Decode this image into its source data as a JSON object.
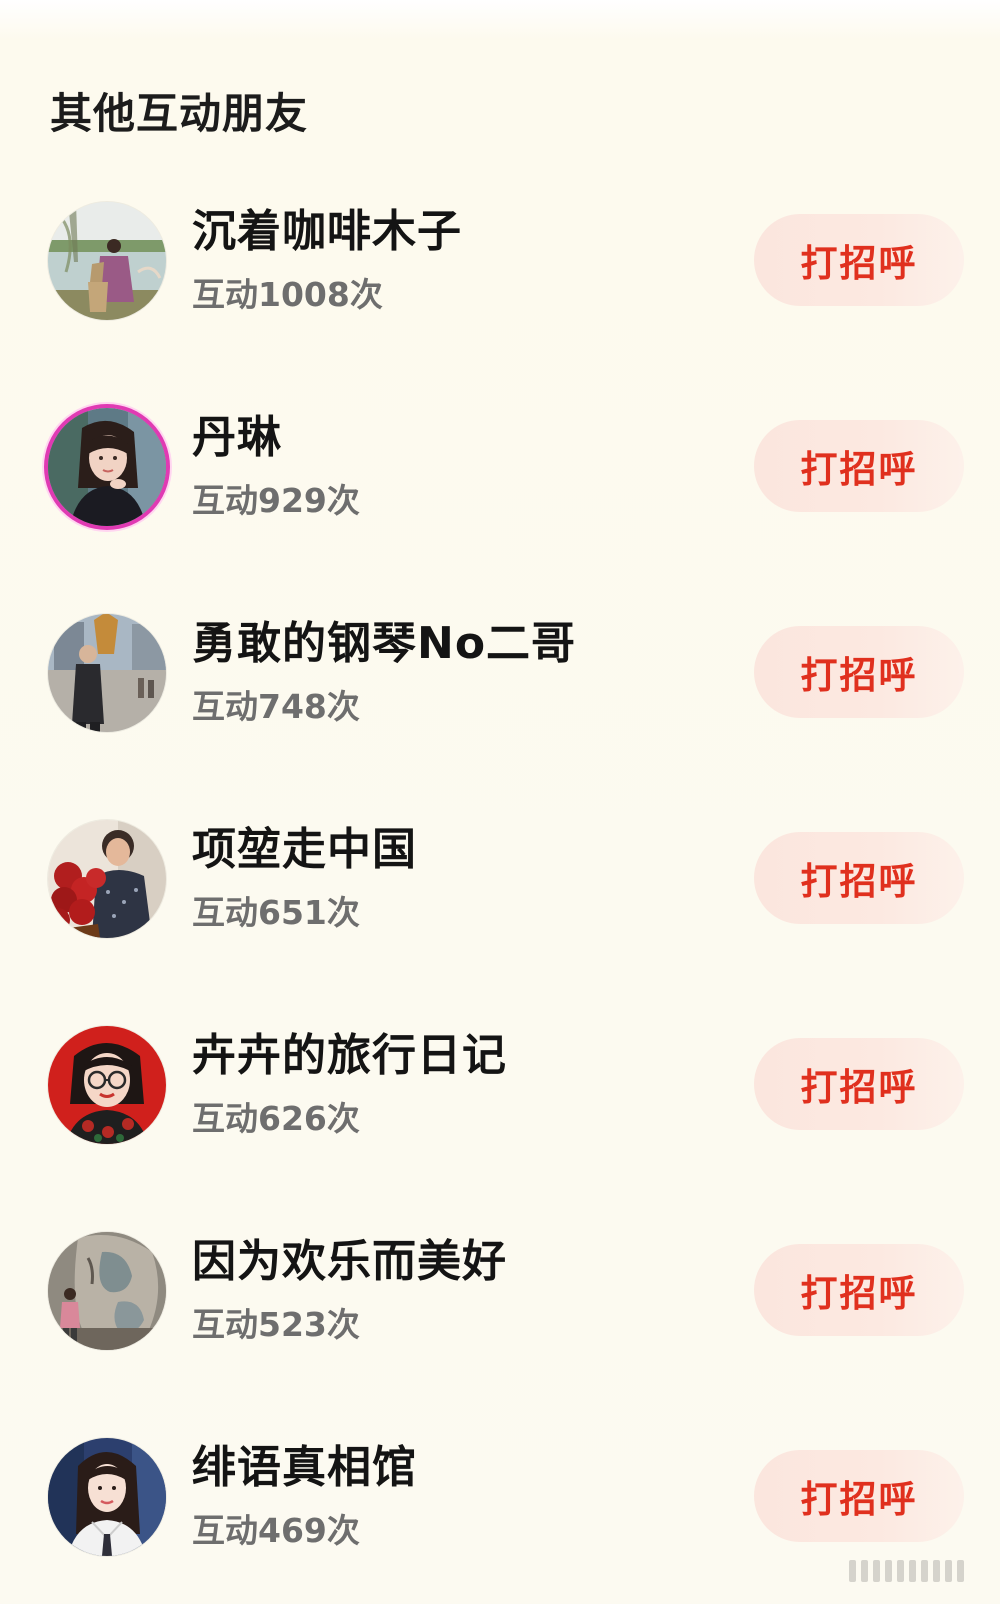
{
  "section": {
    "title": "其他互动朋友"
  },
  "friends": [
    {
      "name": "沉着咖啡木子",
      "count": "互动1008次",
      "button": "打招呼",
      "avatar": "avatar-photo-lake"
    },
    {
      "name": "丹琳",
      "count": "互动929次",
      "button": "打招呼",
      "avatar": "avatar-photo-woman-portrait"
    },
    {
      "name": "勇敢的钢琴No二哥",
      "count": "互动748次",
      "button": "打招呼",
      "avatar": "avatar-photo-man-plaza"
    },
    {
      "name": "项堃走中国",
      "count": "互动651次",
      "button": "打招呼",
      "avatar": "avatar-photo-roses"
    },
    {
      "name": "卉卉的旅行日记",
      "count": "互动626次",
      "button": "打招呼",
      "avatar": "avatar-illustration-glasses"
    },
    {
      "name": "因为欢乐而美好",
      "count": "互动523次",
      "button": "打招呼",
      "avatar": "avatar-photo-sculpture"
    },
    {
      "name": "绯语真相馆",
      "count": "互动469次",
      "button": "打招呼",
      "avatar": "avatar-photo-woman-blue"
    }
  ],
  "colors": {
    "background": "#fcfaf1",
    "button_text": "#e0301e",
    "button_bg": "#fbe6de",
    "name_text": "#141414",
    "count_text": "#6e6e6e"
  }
}
